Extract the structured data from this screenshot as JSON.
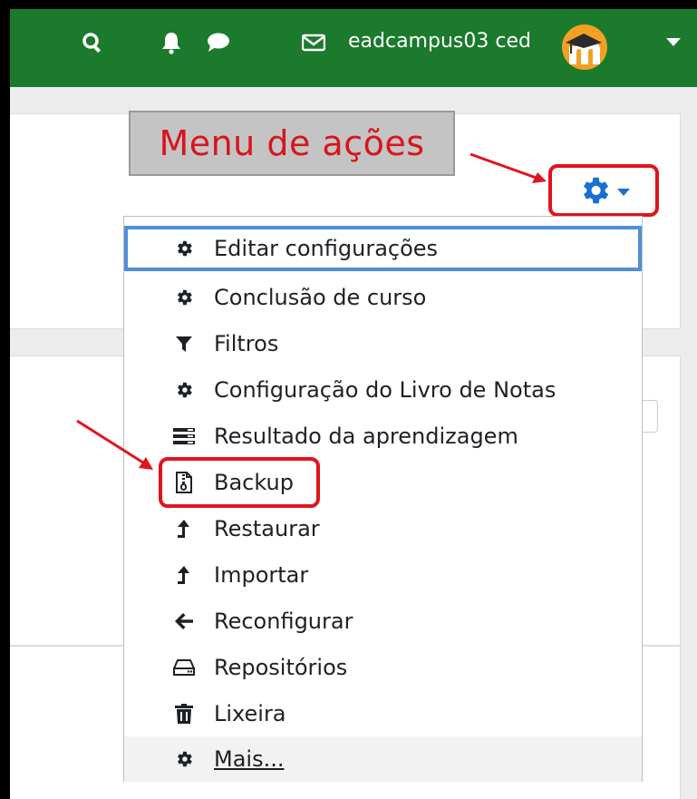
{
  "topbar": {
    "username": "eadcampus03 ced",
    "icons": [
      "search-icon",
      "bell-icon",
      "chat-icon",
      "envelope-icon"
    ],
    "color": "#1b7a2c"
  },
  "annotation": {
    "callout_text": "Menu de ações",
    "highlight_color": "#e0141c"
  },
  "actions_menu": {
    "items": [
      {
        "label": "Editar configurações",
        "icon": "gear-icon"
      },
      {
        "label": "Conclusão de curso",
        "icon": "gear-icon"
      },
      {
        "label": "Filtros",
        "icon": "filter-icon"
      },
      {
        "label": "Configuração do Livro de Notas",
        "icon": "gear-icon"
      },
      {
        "label": "Resultado da aprendizagem",
        "icon": "list-icon"
      },
      {
        "label": "Backup",
        "icon": "file-archive-icon"
      },
      {
        "label": "Restaurar",
        "icon": "level-up-icon"
      },
      {
        "label": "Importar",
        "icon": "level-up-icon"
      },
      {
        "label": "Reconfigurar",
        "icon": "arrow-left-icon"
      },
      {
        "label": "Repositórios",
        "icon": "hdd-icon"
      },
      {
        "label": "Lixeira",
        "icon": "trash-icon"
      },
      {
        "label": "Mais...",
        "icon": "gear-icon"
      }
    ]
  }
}
